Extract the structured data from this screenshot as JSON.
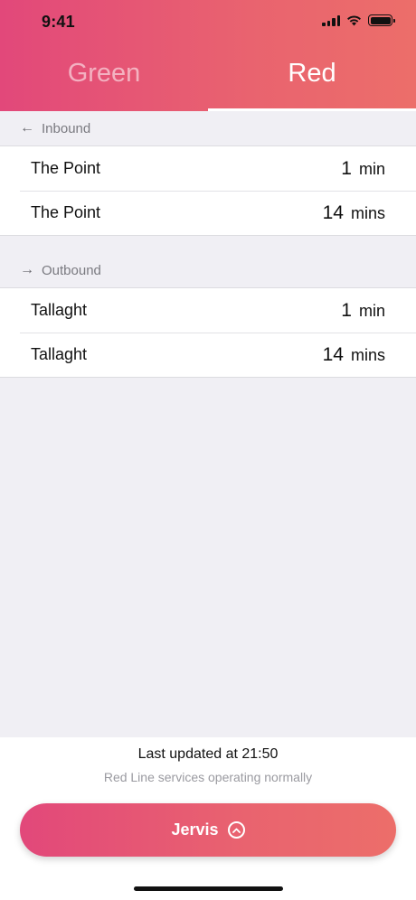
{
  "status_bar": {
    "time": "9:41"
  },
  "tabs": [
    {
      "label": "Green",
      "active": false
    },
    {
      "label": "Red",
      "active": true
    }
  ],
  "inbound": {
    "label": "Inbound",
    "rows": [
      {
        "destination": "The Point",
        "due": "1",
        "unit": "min"
      },
      {
        "destination": "The Point",
        "due": "14",
        "unit": "mins"
      }
    ]
  },
  "outbound": {
    "label": "Outbound",
    "rows": [
      {
        "destination": "Tallaght",
        "due": "1",
        "unit": "min"
      },
      {
        "destination": "Tallaght",
        "due": "14",
        "unit": "mins"
      }
    ]
  },
  "footer": {
    "last_updated": "Last updated at 21:50",
    "service_status": "Red Line services operating normally",
    "stop_button_label": "Jervis"
  },
  "icons": {
    "inbound": "arrow-left-icon",
    "outbound": "arrow-right-icon",
    "stop_button": "chevron-up-circle-icon"
  },
  "colors": {
    "gradient_start": "#e2487a",
    "gradient_end": "#ec6e6a",
    "background": "#f0eff4"
  }
}
